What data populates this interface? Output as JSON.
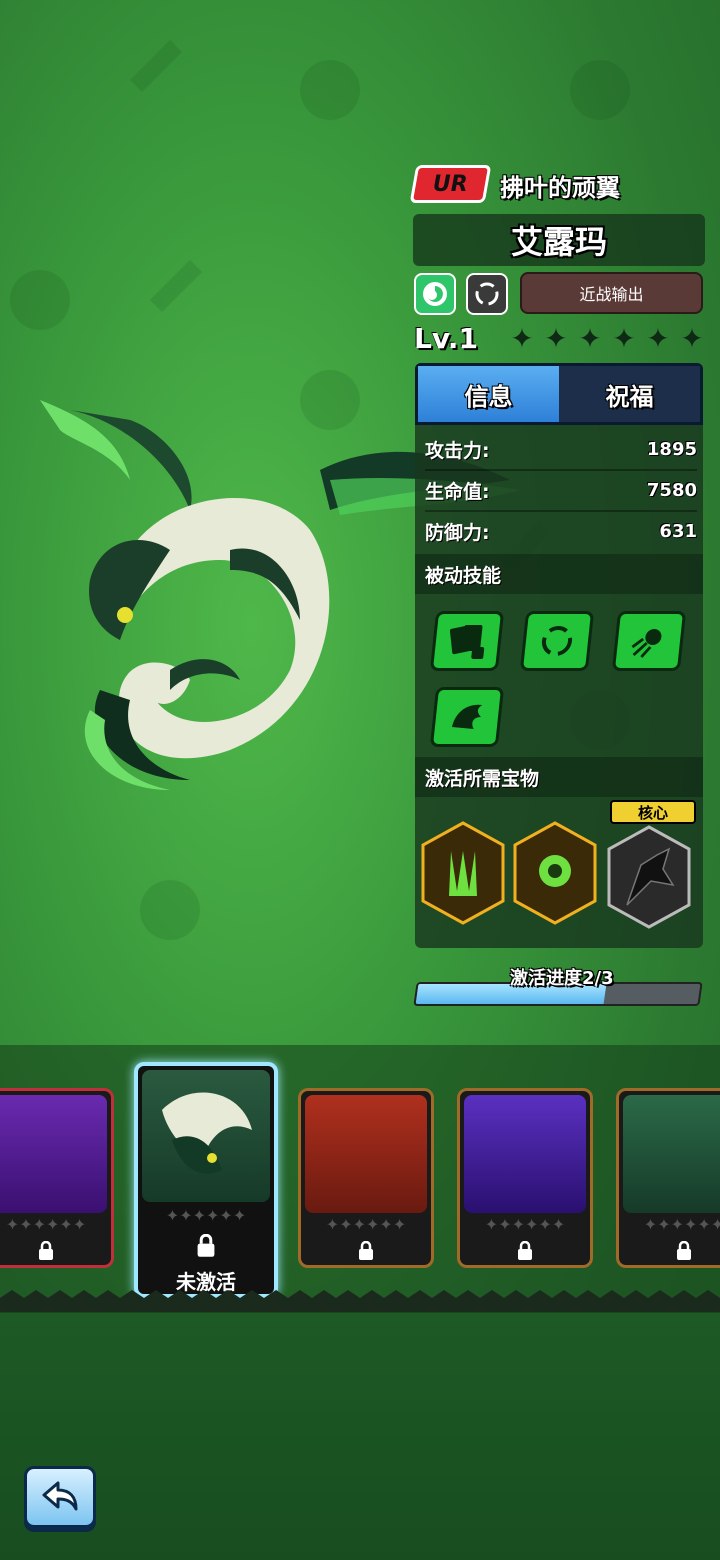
{
  "hero": {
    "rarity": "UR",
    "subtitle": "拂叶的顽翼",
    "name": "艾露玛",
    "role": "近战输出",
    "level": "Lv.1",
    "star_count": 6,
    "element_icon": "wind-swirl-icon",
    "role_icon": "circular-arrows-icon"
  },
  "tabs": [
    {
      "label": "信息",
      "active": true
    },
    {
      "label": "祝福",
      "active": false
    }
  ],
  "stats": [
    {
      "label": "攻击力:",
      "value": "1895"
    },
    {
      "label": "生命值:",
      "value": "7580"
    },
    {
      "label": "防御力:",
      "value": "631"
    }
  ],
  "passive_section": "被动技能",
  "skills": [
    "cards-dice-icon",
    "circular-arrows-icon",
    "comet-icon",
    "dragon-head-icon"
  ],
  "treasure_section": "激活所需宝物",
  "core_label": "核心",
  "treasures": [
    {
      "icon": "green-claw-icon",
      "owned": true
    },
    {
      "icon": "green-orb-icon",
      "owned": true
    },
    {
      "icon": "dark-dragon-icon",
      "owned": false
    }
  ],
  "progress": {
    "label": "激活进度2/3",
    "fraction": 0.667
  },
  "carousel": {
    "selected_caption": "未激活",
    "cards": [
      "purple-dragon",
      "green-dragon",
      "red-beast",
      "violet-dragon",
      "jade-beast"
    ]
  },
  "colors": {
    "ur_red": "#e0262e",
    "active_tab": "#2e80d8",
    "skill_green": "#22c43a",
    "core_yellow": "#f0d030",
    "progress_blue": "#5ab8f0"
  }
}
